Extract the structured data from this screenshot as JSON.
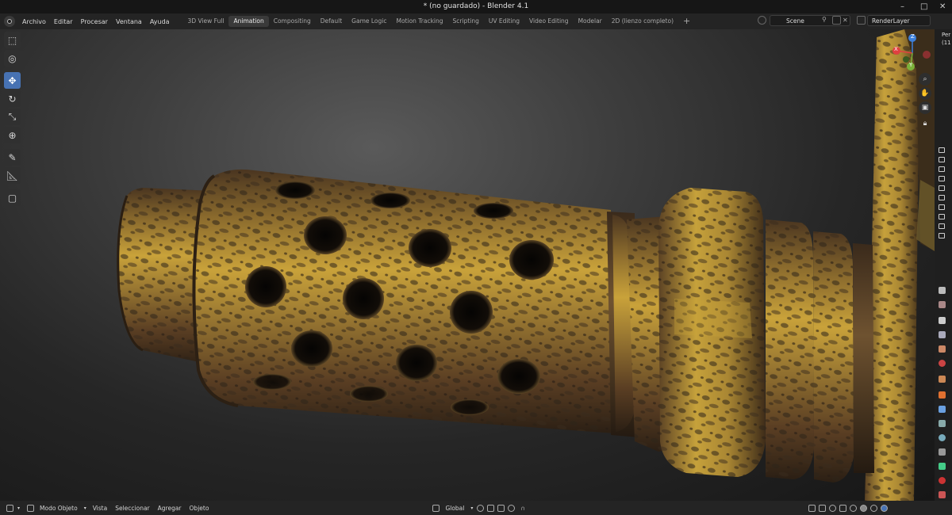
{
  "window": {
    "title": "* (no guardado) - Blender 4.1"
  },
  "menu": [
    "Archivo",
    "Editar",
    "Procesar",
    "Ventana",
    "Ayuda"
  ],
  "workspaces": [
    "3D View Full",
    "Animation",
    "Compositing",
    "Default",
    "Game Logic",
    "Motion Tracking",
    "Scripting",
    "UV Editing",
    "Video Editing",
    "Modelar",
    "2D (lienzo completo)"
  ],
  "active_workspace": "Animation",
  "scene": {
    "name": "Scene",
    "render_layer": "RenderLayer"
  },
  "viewport": {
    "view_label": "Per",
    "view_label2": "(11"
  },
  "statusbar": {
    "mode": "Modo Objeto",
    "menus": [
      "Vista",
      "Seleccionar",
      "Agregar",
      "Objeto"
    ],
    "orientation": "Global"
  },
  "gizmo": {
    "x": "X",
    "y": "Y",
    "z": "Z"
  },
  "colors": {
    "accent": "#4772b3",
    "gizmo_x": "#e04040",
    "gizmo_y": "#7bb23b",
    "gizmo_z": "#3d7fd9",
    "brass": "#c9a23a",
    "rust": "#5a3a22"
  }
}
